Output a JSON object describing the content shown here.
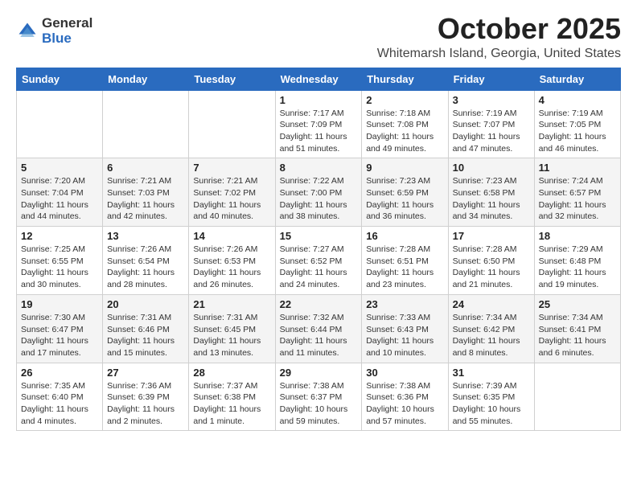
{
  "logo": {
    "general": "General",
    "blue": "Blue"
  },
  "header": {
    "month": "October 2025",
    "location": "Whitemarsh Island, Georgia, United States"
  },
  "days_of_week": [
    "Sunday",
    "Monday",
    "Tuesday",
    "Wednesday",
    "Thursday",
    "Friday",
    "Saturday"
  ],
  "weeks": [
    [
      {
        "day": "",
        "info": ""
      },
      {
        "day": "",
        "info": ""
      },
      {
        "day": "",
        "info": ""
      },
      {
        "day": "1",
        "info": "Sunrise: 7:17 AM\nSunset: 7:09 PM\nDaylight: 11 hours\nand 51 minutes."
      },
      {
        "day": "2",
        "info": "Sunrise: 7:18 AM\nSunset: 7:08 PM\nDaylight: 11 hours\nand 49 minutes."
      },
      {
        "day": "3",
        "info": "Sunrise: 7:19 AM\nSunset: 7:07 PM\nDaylight: 11 hours\nand 47 minutes."
      },
      {
        "day": "4",
        "info": "Sunrise: 7:19 AM\nSunset: 7:05 PM\nDaylight: 11 hours\nand 46 minutes."
      }
    ],
    [
      {
        "day": "5",
        "info": "Sunrise: 7:20 AM\nSunset: 7:04 PM\nDaylight: 11 hours\nand 44 minutes."
      },
      {
        "day": "6",
        "info": "Sunrise: 7:21 AM\nSunset: 7:03 PM\nDaylight: 11 hours\nand 42 minutes."
      },
      {
        "day": "7",
        "info": "Sunrise: 7:21 AM\nSunset: 7:02 PM\nDaylight: 11 hours\nand 40 minutes."
      },
      {
        "day": "8",
        "info": "Sunrise: 7:22 AM\nSunset: 7:00 PM\nDaylight: 11 hours\nand 38 minutes."
      },
      {
        "day": "9",
        "info": "Sunrise: 7:23 AM\nSunset: 6:59 PM\nDaylight: 11 hours\nand 36 minutes."
      },
      {
        "day": "10",
        "info": "Sunrise: 7:23 AM\nSunset: 6:58 PM\nDaylight: 11 hours\nand 34 minutes."
      },
      {
        "day": "11",
        "info": "Sunrise: 7:24 AM\nSunset: 6:57 PM\nDaylight: 11 hours\nand 32 minutes."
      }
    ],
    [
      {
        "day": "12",
        "info": "Sunrise: 7:25 AM\nSunset: 6:55 PM\nDaylight: 11 hours\nand 30 minutes."
      },
      {
        "day": "13",
        "info": "Sunrise: 7:26 AM\nSunset: 6:54 PM\nDaylight: 11 hours\nand 28 minutes."
      },
      {
        "day": "14",
        "info": "Sunrise: 7:26 AM\nSunset: 6:53 PM\nDaylight: 11 hours\nand 26 minutes."
      },
      {
        "day": "15",
        "info": "Sunrise: 7:27 AM\nSunset: 6:52 PM\nDaylight: 11 hours\nand 24 minutes."
      },
      {
        "day": "16",
        "info": "Sunrise: 7:28 AM\nSunset: 6:51 PM\nDaylight: 11 hours\nand 23 minutes."
      },
      {
        "day": "17",
        "info": "Sunrise: 7:28 AM\nSunset: 6:50 PM\nDaylight: 11 hours\nand 21 minutes."
      },
      {
        "day": "18",
        "info": "Sunrise: 7:29 AM\nSunset: 6:48 PM\nDaylight: 11 hours\nand 19 minutes."
      }
    ],
    [
      {
        "day": "19",
        "info": "Sunrise: 7:30 AM\nSunset: 6:47 PM\nDaylight: 11 hours\nand 17 minutes."
      },
      {
        "day": "20",
        "info": "Sunrise: 7:31 AM\nSunset: 6:46 PM\nDaylight: 11 hours\nand 15 minutes."
      },
      {
        "day": "21",
        "info": "Sunrise: 7:31 AM\nSunset: 6:45 PM\nDaylight: 11 hours\nand 13 minutes."
      },
      {
        "day": "22",
        "info": "Sunrise: 7:32 AM\nSunset: 6:44 PM\nDaylight: 11 hours\nand 11 minutes."
      },
      {
        "day": "23",
        "info": "Sunrise: 7:33 AM\nSunset: 6:43 PM\nDaylight: 11 hours\nand 10 minutes."
      },
      {
        "day": "24",
        "info": "Sunrise: 7:34 AM\nSunset: 6:42 PM\nDaylight: 11 hours\nand 8 minutes."
      },
      {
        "day": "25",
        "info": "Sunrise: 7:34 AM\nSunset: 6:41 PM\nDaylight: 11 hours\nand 6 minutes."
      }
    ],
    [
      {
        "day": "26",
        "info": "Sunrise: 7:35 AM\nSunset: 6:40 PM\nDaylight: 11 hours\nand 4 minutes."
      },
      {
        "day": "27",
        "info": "Sunrise: 7:36 AM\nSunset: 6:39 PM\nDaylight: 11 hours\nand 2 minutes."
      },
      {
        "day": "28",
        "info": "Sunrise: 7:37 AM\nSunset: 6:38 PM\nDaylight: 11 hours\nand 1 minute."
      },
      {
        "day": "29",
        "info": "Sunrise: 7:38 AM\nSunset: 6:37 PM\nDaylight: 10 hours\nand 59 minutes."
      },
      {
        "day": "30",
        "info": "Sunrise: 7:38 AM\nSunset: 6:36 PM\nDaylight: 10 hours\nand 57 minutes."
      },
      {
        "day": "31",
        "info": "Sunrise: 7:39 AM\nSunset: 6:35 PM\nDaylight: 10 hours\nand 55 minutes."
      },
      {
        "day": "",
        "info": ""
      }
    ]
  ]
}
